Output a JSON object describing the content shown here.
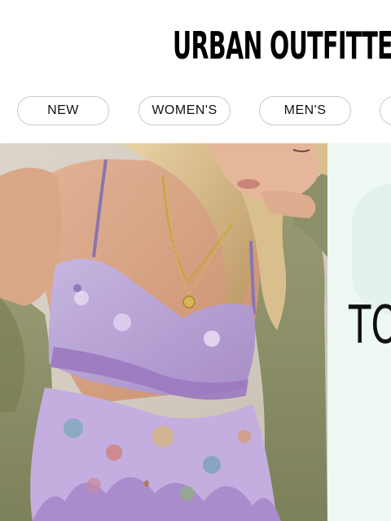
{
  "header": {
    "logo_text": "URBAN OUTFITTERS"
  },
  "nav": {
    "pills": [
      {
        "label": "NEW"
      },
      {
        "label": "WOMEN'S"
      },
      {
        "label": "MEN'S"
      },
      {
        "label": ""
      }
    ]
  },
  "hero": {
    "image_subject": "model in lavender lace ruffle cami with olive jacket and gold necklaces",
    "promo_text": "TO"
  },
  "colors": {
    "background": "#ffffff",
    "text": "#111111",
    "pill_border": "#c9c9c9",
    "promo_background": "#eef9f4",
    "top_lavender": "#b49ad0",
    "jacket_olive": "#8a8e64"
  }
}
